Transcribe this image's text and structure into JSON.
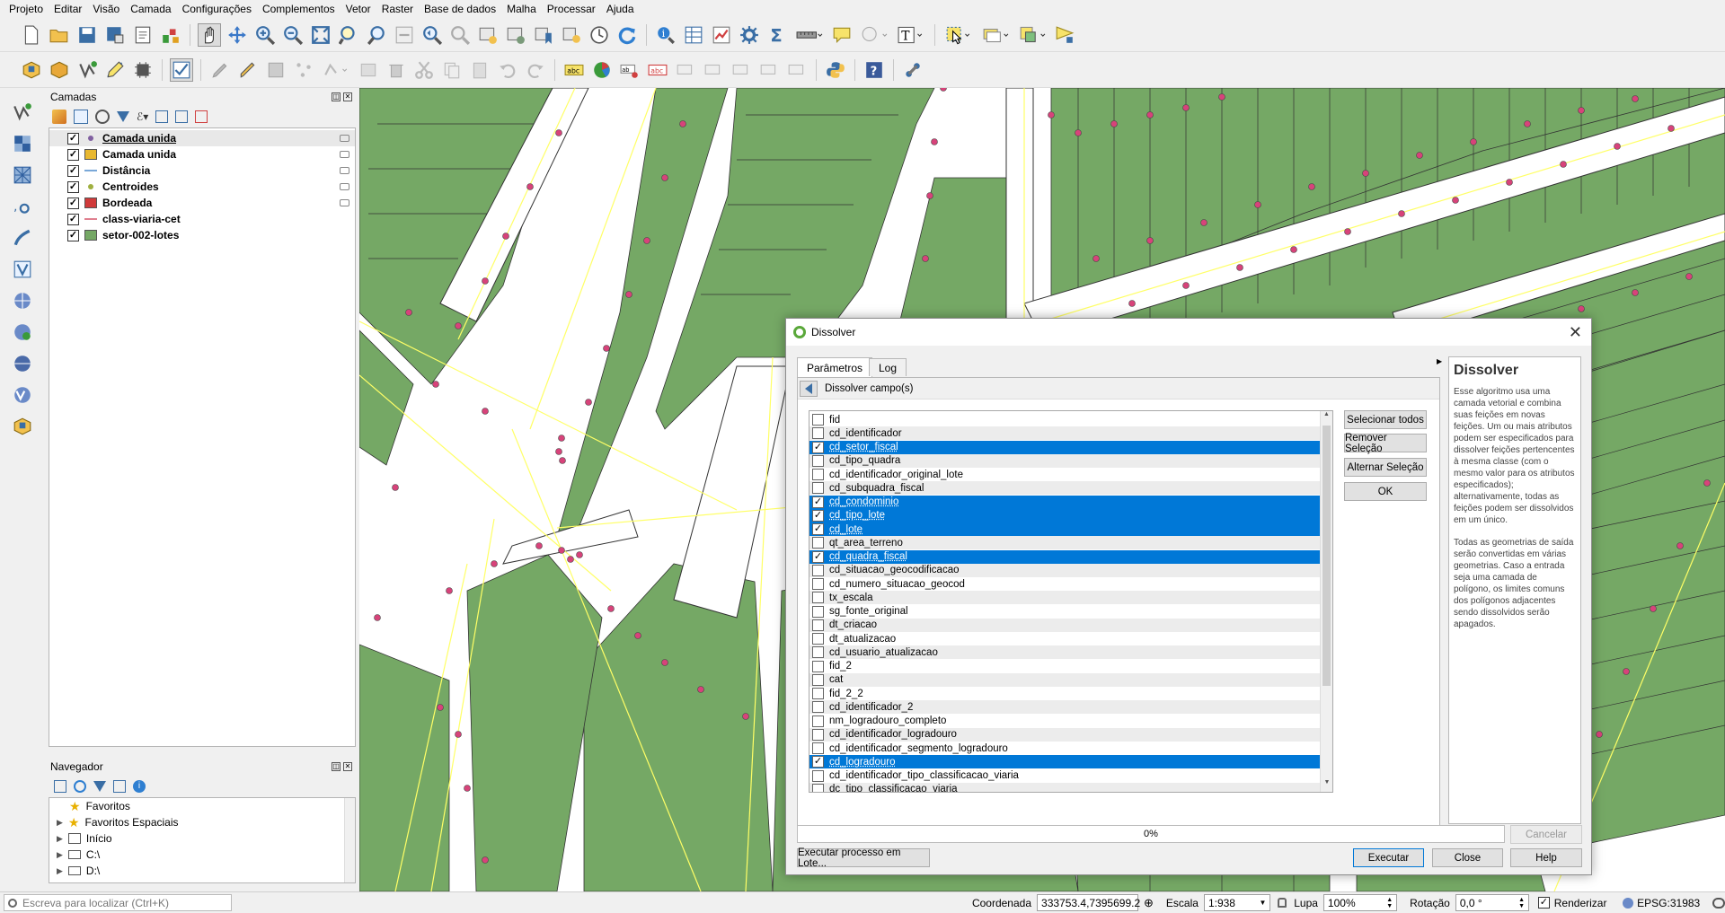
{
  "menu": [
    "Projeto",
    "Editar",
    "Visão",
    "Camada",
    "Configurações",
    "Complementos",
    "Vetor",
    "Raster",
    "Base de dados",
    "Malha",
    "Processar",
    "Ajuda"
  ],
  "layers_panel": {
    "title": "Camadas",
    "layers": [
      {
        "name": "Camada unida",
        "checked": true,
        "symbol": "point",
        "color": "#8060a0",
        "underline": true
      },
      {
        "name": "Camada unida",
        "checked": true,
        "symbol": "polygon",
        "color": "#e8b830"
      },
      {
        "name": "Distância",
        "checked": true,
        "symbol": "line",
        "color": "#7aa8d8"
      },
      {
        "name": "Centroides",
        "checked": true,
        "symbol": "point",
        "color": "#a0b040"
      },
      {
        "name": "Bordeada",
        "checked": true,
        "symbol": "polygon",
        "color": "#d03a3a"
      },
      {
        "name": "class-viaria-cet",
        "checked": true,
        "symbol": "line",
        "color": "#e08090"
      },
      {
        "name": "setor-002-lotes",
        "checked": true,
        "symbol": "polygon",
        "color": "#75a865"
      }
    ]
  },
  "navigator_panel": {
    "title": "Navegador",
    "items": [
      "Favoritos",
      "Favoritos Espaciais",
      "Início",
      "C:\\",
      "D:\\"
    ]
  },
  "dialog": {
    "title": "Dissolver",
    "tabs": [
      "Parâmetros",
      "Log"
    ],
    "section_label": "Dissolver campo(s)",
    "fields": [
      {
        "name": "fid",
        "checked": false
      },
      {
        "name": "cd_identificador",
        "checked": false
      },
      {
        "name": "cd_setor_fiscal",
        "checked": true
      },
      {
        "name": "cd_tipo_quadra",
        "checked": false
      },
      {
        "name": "cd_identificador_original_lote",
        "checked": false
      },
      {
        "name": "cd_subquadra_fiscal",
        "checked": false
      },
      {
        "name": "cd_condominio",
        "checked": true
      },
      {
        "name": "cd_tipo_lote",
        "checked": true
      },
      {
        "name": "cd_lote",
        "checked": true
      },
      {
        "name": "qt_area_terreno",
        "checked": false
      },
      {
        "name": "cd_quadra_fiscal",
        "checked": true
      },
      {
        "name": "cd_situacao_geocodificacao",
        "checked": false
      },
      {
        "name": "cd_numero_situacao_geocod",
        "checked": false
      },
      {
        "name": "tx_escala",
        "checked": false
      },
      {
        "name": "sg_fonte_original",
        "checked": false
      },
      {
        "name": "dt_criacao",
        "checked": false
      },
      {
        "name": "dt_atualizacao",
        "checked": false
      },
      {
        "name": "cd_usuario_atualizacao",
        "checked": false
      },
      {
        "name": "fid_2",
        "checked": false
      },
      {
        "name": "cat",
        "checked": false
      },
      {
        "name": "fid_2_2",
        "checked": false
      },
      {
        "name": "cd_identificador_2",
        "checked": false
      },
      {
        "name": "nm_logradouro_completo",
        "checked": false
      },
      {
        "name": "cd_identificador_logradouro",
        "checked": false
      },
      {
        "name": "cd_identificador_segmento_logradouro",
        "checked": false
      },
      {
        "name": "cd_logradouro",
        "checked": true
      },
      {
        "name": "cd_identificador_tipo_classificacao_viaria",
        "checked": false
      },
      {
        "name": "dc_tipo_classificacao_viaria",
        "checked": false
      }
    ],
    "buttons": {
      "select_all": "Selecionar todos",
      "remove_selection": "Remover Seleção",
      "toggle_selection": "Alternar Seleção",
      "ok": "OK",
      "batch": "Executar processo em Lote...",
      "cancel": "Cancelar",
      "run": "Executar",
      "close": "Close",
      "help": "Help"
    },
    "progress": "0%",
    "help_title": "Dissolver",
    "help_p1": "Esse algoritmo usa uma camada vetorial e combina suas feições em novas feições. Um ou mais atributos podem ser especificados para dissolver feições pertencentes à mesma classe (com o mesmo valor para os atributos especificados); alternativamente, todas as feições podem ser dissolvidos em um único.",
    "help_p2": "Todas as geometrias de saída serão convertidas em várias geometrias. Caso a entrada seja uma camada de polígono, os limites comuns dos polígonos adjacentes sendo dissolvidos serão apagados."
  },
  "statusbar": {
    "search_placeholder": "Escreva para localizar (Ctrl+K)",
    "coord_label": "Coordenada",
    "coord_value": "333753.4,7395699.2",
    "scale_label": "Escala",
    "scale_value": "1:938",
    "zoom_label": "Lupa",
    "zoom_value": "100%",
    "rotation_label": "Rotação",
    "rotation_value": "0,0 °",
    "render_label": "Renderizar",
    "crs": "EPSG:31983"
  },
  "colors": {
    "parcel": "#75a865",
    "selection": "#0078d7",
    "road_line": "#ffff66",
    "vertex": "#d7437a"
  }
}
